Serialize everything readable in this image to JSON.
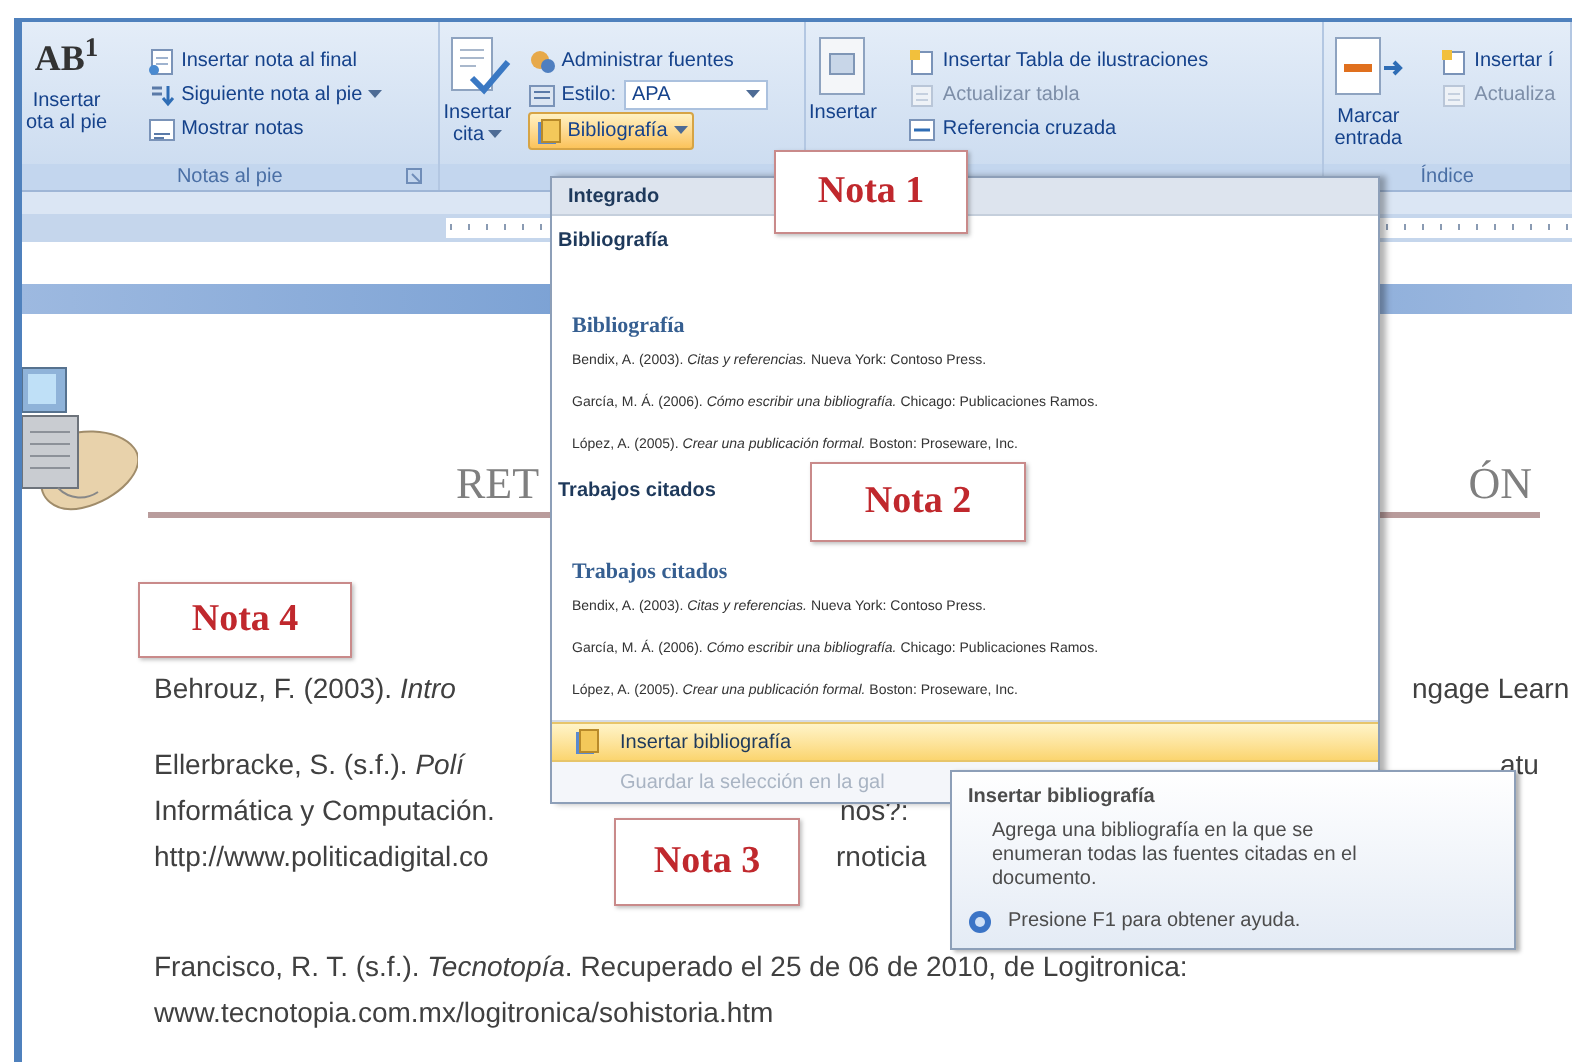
{
  "ribbon": {
    "groups": [
      {
        "label": "Notas al pie",
        "large_button": {
          "icon_text": "AB$^{1}$",
          "lines": [
            "Insertar",
            "ota al pie"
          ],
          "dropdown": false
        },
        "items": [
          {
            "kind": "button",
            "label": "Insertar nota al final",
            "disabled": false,
            "dropdown": false
          },
          {
            "kind": "button",
            "label": "Siguiente nota al pie",
            "disabled": false,
            "dropdown": true
          },
          {
            "kind": "button",
            "label": "Mostrar notas",
            "disabled": false,
            "dropdown": false
          }
        ]
      },
      {
        "large_button": {
          "lines": [
            "Insertar",
            "cita"
          ],
          "dropdown": true
        },
        "items": [
          {
            "kind": "button",
            "label": "Administrar fuentes",
            "disabled": false,
            "dropdown": false
          },
          {
            "kind": "select",
            "label": "Estilo:",
            "value": "APA"
          },
          {
            "kind": "menu_button",
            "label": "Bibliografía",
            "open": true,
            "dropdown": true
          }
        ]
      },
      {
        "large_button": {
          "lines": [
            "Insertar"
          ],
          "dropdown": false
        },
        "items": [
          {
            "kind": "button",
            "label": "Insertar Tabla de ilustraciones",
            "disabled": false,
            "dropdown": false
          },
          {
            "kind": "button",
            "label": "Actualizar tabla",
            "disabled": true,
            "dropdown": false
          },
          {
            "kind": "button",
            "label": "Referencia cruzada",
            "disabled": false,
            "dropdown": false
          }
        ]
      },
      {
        "label": "Índice",
        "large_button": {
          "lines": [
            "Marcar",
            "entrada"
          ],
          "dropdown": false
        },
        "items": [
          {
            "kind": "button",
            "label": "Insertar í",
            "disabled": false,
            "dropdown": false
          },
          {
            "kind": "button",
            "label": "Actualiza",
            "disabled": true,
            "dropdown": false
          }
        ]
      }
    ]
  },
  "document": {
    "title_left": "RET",
    "title_right": "ÓN",
    "references": [
      {
        "lines": [
          {
            "left": "Behrouz, F. (2003). *Intro*",
            "right": "ngage Learn"
          }
        ]
      },
      {
        "lines": [
          {
            "left": "Ellerbracke, S. (s.f.). *Polí*",
            "right": "atu"
          },
          {
            "left": "Informática y Computación.",
            "right": "nos?:"
          },
          {
            "left": "http://www.politicadigital.co",
            "right": "rnoticia"
          }
        ]
      },
      {
        "lines": [
          {
            "left": "Francisco, R. T. (s.f.). *Tecnotopía*. Recuperado el 25 de 06 de 2010, de Logitronica:"
          },
          {
            "left": "www.tecnotopia.com.mx/logitronica/sohistoria.htm"
          }
        ]
      }
    ]
  },
  "bibliography_menu": {
    "header": "Integrado",
    "sections": [
      {
        "label": "Bibliografía",
        "preview": {
          "heading": "Bibliografía",
          "entries": [
            "Bendix, A. (2003). *Citas y referencias.* Nueva York: Contoso Press.",
            "García, M. Á. (2006). *Cómo escribir una bibliografía.* Chicago: Publicaciones Ramos.",
            "López, A. (2005). *Crear una publicación formal.* Boston: Proseware, Inc."
          ]
        }
      },
      {
        "label": "Trabajos citados",
        "preview": {
          "heading": "Trabajos citados",
          "entries": [
            "Bendix, A. (2003). *Citas y referencias.* Nueva York: Contoso Press.",
            "García, M. Á. (2006). *Cómo escribir una bibliografía.* Chicago: Publicaciones Ramos.",
            "López, A. (2005). *Crear una publicación formal.* Boston: Proseware, Inc."
          ]
        }
      }
    ],
    "actions": [
      {
        "label": "Insertar bibliografía",
        "selected": true,
        "disabled": false
      },
      {
        "label": "Guardar la selección en la gal",
        "selected": false,
        "disabled": true
      }
    ]
  },
  "tooltip": {
    "title": "Insertar bibliografía",
    "body": "Agrega una bibliografía en la que se enumeran todas las fuentes citadas en el documento.",
    "help": "Presione F1 para obtener ayuda."
  },
  "callouts": [
    {
      "label": "Nota 1"
    },
    {
      "label": "Nota 2"
    },
    {
      "label": "Nota 3"
    },
    {
      "label": "Nota 4"
    }
  ]
}
